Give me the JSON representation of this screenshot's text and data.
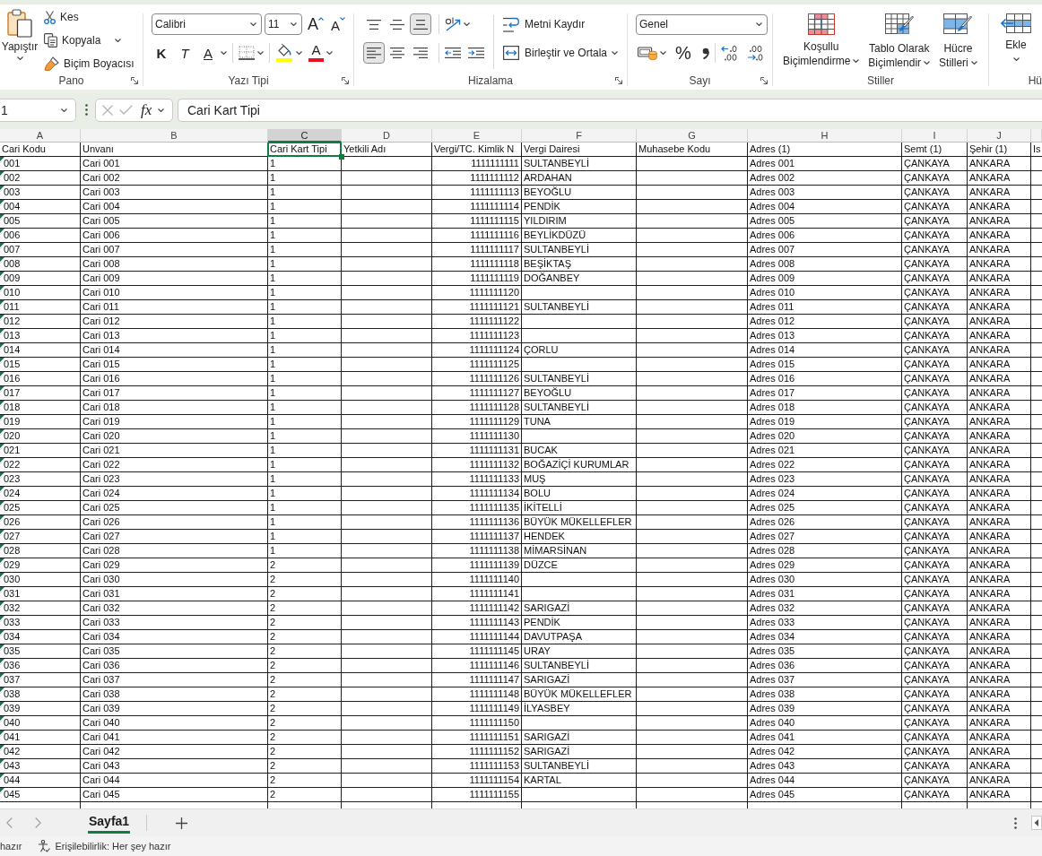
{
  "ribbon": {
    "clipboard": {
      "label": "Pano",
      "paste": "Yapıştır",
      "cut": "Kes",
      "copy": "Kopyala",
      "format_painter": "Biçim Boyacısı"
    },
    "font": {
      "label": "Yazı Tipi",
      "font_name": "Calibri",
      "font_size": "11",
      "grow_font": "A",
      "shrink_font": "A",
      "bold": "K",
      "italic": "T",
      "underline": "A",
      "font_color": "A"
    },
    "alignment": {
      "label": "Hizalama",
      "vertical": [
        {
          "kind": "top",
          "selected": false
        },
        {
          "kind": "middle",
          "selected": false
        },
        {
          "kind": "bottom",
          "selected": true
        }
      ],
      "horizontal": [
        {
          "kind": "left",
          "selected": true
        },
        {
          "kind": "center",
          "selected": false
        },
        {
          "kind": "right",
          "selected": false
        }
      ],
      "wrap_text": "Metni Kaydır",
      "merge_center": "Birleştir ve Ortala"
    },
    "number": {
      "label": "Sayı",
      "format": "Genel",
      "percent": "%"
    },
    "styles": {
      "label": "Stiller",
      "buttons": [
        {
          "kind": "conditional",
          "lines": [
            "Koşullu",
            "Biçimlendirme"
          ]
        },
        {
          "kind": "table",
          "lines": [
            "Tablo Olarak",
            "Biçimlendir"
          ]
        },
        {
          "kind": "cell",
          "lines": [
            "Hücre",
            "Stilleri"
          ]
        }
      ]
    },
    "cells": {
      "label": "Hü",
      "insert": "Ekle"
    }
  },
  "formula_bar": {
    "name_box": "1",
    "function_button": "fx",
    "formula": "Cari Kart Tipi"
  },
  "sheet": {
    "columns": [
      {
        "letter": "A",
        "heading": "Cari Kodu",
        "selected": false
      },
      {
        "letter": "B",
        "heading": "Unvanı",
        "selected": false
      },
      {
        "letter": "C",
        "heading": "Cari Kart Tipi",
        "selected": true
      },
      {
        "letter": "D",
        "heading": "Yetkili Adı",
        "selected": false
      },
      {
        "letter": "E",
        "heading": "Vergi/TC. Kimlik N",
        "selected": false
      },
      {
        "letter": "F",
        "heading": "Vergi Dairesi",
        "selected": false
      },
      {
        "letter": "G",
        "heading": "Muhasebe Kodu",
        "selected": false
      },
      {
        "letter": "H",
        "heading": "Adres (1)",
        "selected": false
      },
      {
        "letter": "I",
        "heading": "Semt (1)",
        "selected": false
      },
      {
        "letter": "J",
        "heading": "Şehir (1)",
        "selected": false
      },
      {
        "heading": "Is",
        "selected": false
      }
    ],
    "rows": [
      {
        "code": "001",
        "title": "Cari 001",
        "card_type": "1",
        "tax_number": "1111111111",
        "tax_office": "SULTANBEYLİ",
        "address": "Adres 001",
        "district": "ÇANKAYA",
        "city": "ANKARA",
        "warning": true
      },
      {
        "code": "002",
        "title": "Cari 002",
        "card_type": "1",
        "tax_number": "1111111112",
        "tax_office": "ARDAHAN",
        "address": "Adres 002",
        "district": "ÇANKAYA",
        "city": "ANKARA",
        "warning": true
      },
      {
        "code": "003",
        "title": "Cari 003",
        "card_type": "1",
        "tax_number": "1111111113",
        "tax_office": "BEYOĞLU",
        "address": "Adres 003",
        "district": "ÇANKAYA",
        "city": "ANKARA",
        "warning": true
      },
      {
        "code": "004",
        "title": "Cari 004",
        "card_type": "1",
        "tax_number": "1111111114",
        "tax_office": "PENDİK",
        "address": "Adres 004",
        "district": "ÇANKAYA",
        "city": "ANKARA",
        "warning": true
      },
      {
        "code": "005",
        "title": "Cari 005",
        "card_type": "1",
        "tax_number": "1111111115",
        "tax_office": "YILDIRIM",
        "address": "Adres 005",
        "district": "ÇANKAYA",
        "city": "ANKARA",
        "warning": true
      },
      {
        "code": "006",
        "title": "Cari 006",
        "card_type": "1",
        "tax_number": "1111111116",
        "tax_office": "BEYLİKDÜZÜ",
        "address": "Adres 006",
        "district": "ÇANKAYA",
        "city": "ANKARA",
        "warning": true
      },
      {
        "code": "007",
        "title": "Cari 007",
        "card_type": "1",
        "tax_number": "1111111117",
        "tax_office": "SULTANBEYLİ",
        "address": "Adres 007",
        "district": "ÇANKAYA",
        "city": "ANKARA",
        "warning": true
      },
      {
        "code": "008",
        "title": "Cari 008",
        "card_type": "1",
        "tax_number": "1111111118",
        "tax_office": "BEŞİKTAŞ",
        "address": "Adres 008",
        "district": "ÇANKAYA",
        "city": "ANKARA",
        "warning": true
      },
      {
        "code": "009",
        "title": "Cari 009",
        "card_type": "1",
        "tax_number": "1111111119",
        "tax_office": "DOĞANBEY",
        "address": "Adres 009",
        "district": "ÇANKAYA",
        "city": "ANKARA",
        "warning": true
      },
      {
        "code": "010",
        "title": "Cari 010",
        "card_type": "1",
        "tax_number": "1111111120",
        "address": "Adres 010",
        "district": "ÇANKAYA",
        "city": "ANKARA",
        "warning": true
      },
      {
        "code": "011",
        "title": "Cari 011",
        "card_type": "1",
        "tax_number": "1111111121",
        "tax_office": "SULTANBEYLİ",
        "address": "Adres 011",
        "district": "ÇANKAYA",
        "city": "ANKARA",
        "warning": true
      },
      {
        "code": "012",
        "title": "Cari 012",
        "card_type": "1",
        "tax_number": "1111111122",
        "address": "Adres 012",
        "district": "ÇANKAYA",
        "city": "ANKARA",
        "warning": true
      },
      {
        "code": "013",
        "title": "Cari 013",
        "card_type": "1",
        "tax_number": "1111111123",
        "address": "Adres 013",
        "district": "ÇANKAYA",
        "city": "ANKARA",
        "warning": true
      },
      {
        "code": "014",
        "title": "Cari 014",
        "card_type": "1",
        "tax_number": "1111111124",
        "tax_office": "ÇORLU",
        "address": "Adres 014",
        "district": "ÇANKAYA",
        "city": "ANKARA",
        "warning": true
      },
      {
        "code": "015",
        "title": "Cari 015",
        "card_type": "1",
        "tax_number": "1111111125",
        "address": "Adres 015",
        "district": "ÇANKAYA",
        "city": "ANKARA",
        "warning": true
      },
      {
        "code": "016",
        "title": "Cari 016",
        "card_type": "1",
        "tax_number": "1111111126",
        "tax_office": "SULTANBEYLİ",
        "address": "Adres 016",
        "district": "ÇANKAYA",
        "city": "ANKARA",
        "warning": true
      },
      {
        "code": "017",
        "title": "Cari 017",
        "card_type": "1",
        "tax_number": "1111111127",
        "tax_office": "BEYOĞLU",
        "address": "Adres 017",
        "district": "ÇANKAYA",
        "city": "ANKARA",
        "warning": true
      },
      {
        "code": "018",
        "title": "Cari 018",
        "card_type": "1",
        "tax_number": "1111111128",
        "tax_office": "SULTANBEYLİ",
        "address": "Adres 018",
        "district": "ÇANKAYA",
        "city": "ANKARA",
        "warning": true
      },
      {
        "code": "019",
        "title": "Cari 019",
        "card_type": "1",
        "tax_number": "1111111129",
        "tax_office": "TUNA",
        "address": "Adres 019",
        "district": "ÇANKAYA",
        "city": "ANKARA",
        "warning": true
      },
      {
        "code": "020",
        "title": "Cari 020",
        "card_type": "1",
        "tax_number": "1111111130",
        "address": "Adres 020",
        "district": "ÇANKAYA",
        "city": "ANKARA",
        "warning": true
      },
      {
        "code": "021",
        "title": "Cari 021",
        "card_type": "1",
        "tax_number": "1111111131",
        "tax_office": "BUCAK",
        "address": "Adres 021",
        "district": "ÇANKAYA",
        "city": "ANKARA",
        "warning": true
      },
      {
        "code": "022",
        "title": "Cari 022",
        "card_type": "1",
        "tax_number": "1111111132",
        "tax_office": "BOĞAZİÇİ KURUMLAR",
        "address": "Adres 022",
        "district": "ÇANKAYA",
        "city": "ANKARA",
        "warning": true
      },
      {
        "code": "023",
        "title": "Cari 023",
        "card_type": "1",
        "tax_number": "1111111133",
        "tax_office": "MUŞ",
        "address": "Adres 023",
        "district": "ÇANKAYA",
        "city": "ANKARA",
        "warning": true
      },
      {
        "code": "024",
        "title": "Cari 024",
        "card_type": "1",
        "tax_number": "1111111134",
        "tax_office": "BOLU",
        "address": "Adres 024",
        "district": "ÇANKAYA",
        "city": "ANKARA",
        "warning": true
      },
      {
        "code": "025",
        "title": "Cari 025",
        "card_type": "1",
        "tax_number": "1111111135",
        "tax_office": "İKİTELLİ",
        "address": "Adres 025",
        "district": "ÇANKAYA",
        "city": "ANKARA",
        "warning": true
      },
      {
        "code": "026",
        "title": "Cari 026",
        "card_type": "1",
        "tax_number": "1111111136",
        "tax_office": "BÜYÜK MÜKELLEFLER",
        "address": "Adres 026",
        "district": "ÇANKAYA",
        "city": "ANKARA",
        "warning": true
      },
      {
        "code": "027",
        "title": "Cari 027",
        "card_type": "1",
        "tax_number": "1111111137",
        "tax_office": "HENDEK",
        "address": "Adres 027",
        "district": "ÇANKAYA",
        "city": "ANKARA",
        "warning": true
      },
      {
        "code": "028",
        "title": "Cari 028",
        "card_type": "1",
        "tax_number": "1111111138",
        "tax_office": "MİMARSİNAN",
        "address": "Adres 028",
        "district": "ÇANKAYA",
        "city": "ANKARA",
        "warning": true
      },
      {
        "code": "029",
        "title": "Cari 029",
        "card_type": "2",
        "tax_number": "1111111139",
        "tax_office": "DÜZCE",
        "address": "Adres 029",
        "district": "ÇANKAYA",
        "city": "ANKARA",
        "warning": true
      },
      {
        "code": "030",
        "title": "Cari 030",
        "card_type": "2",
        "tax_number": "1111111140",
        "address": "Adres 030",
        "district": "ÇANKAYA",
        "city": "ANKARA",
        "warning": true
      },
      {
        "code": "031",
        "title": "Cari 031",
        "card_type": "2",
        "tax_number": "1111111141",
        "address": "Adres 031",
        "district": "ÇANKAYA",
        "city": "ANKARA",
        "warning": true
      },
      {
        "code": "032",
        "title": "Cari 032",
        "card_type": "2",
        "tax_number": "1111111142",
        "tax_office": "SARIGAZİ",
        "address": "Adres 032",
        "district": "ÇANKAYA",
        "city": "ANKARA",
        "warning": true
      },
      {
        "code": "033",
        "title": "Cari 033",
        "card_type": "2",
        "tax_number": "1111111143",
        "tax_office": "PENDİK",
        "address": "Adres 033",
        "district": "ÇANKAYA",
        "city": "ANKARA",
        "warning": true
      },
      {
        "code": "034",
        "title": "Cari 034",
        "card_type": "2",
        "tax_number": "1111111144",
        "tax_office": "DAVUTPAŞA",
        "address": "Adres 034",
        "district": "ÇANKAYA",
        "city": "ANKARA",
        "warning": true
      },
      {
        "code": "035",
        "title": "Cari 035",
        "card_type": "2",
        "tax_number": "1111111145",
        "tax_office": "URAY",
        "address": "Adres 035",
        "district": "ÇANKAYA",
        "city": "ANKARA",
        "warning": true
      },
      {
        "code": "036",
        "title": "Cari 036",
        "card_type": "2",
        "tax_number": "1111111146",
        "tax_office": "SULTANBEYLİ",
        "address": "Adres 036",
        "district": "ÇANKAYA",
        "city": "ANKARA",
        "warning": true
      },
      {
        "code": "037",
        "title": "Cari 037",
        "card_type": "2",
        "tax_number": "1111111147",
        "tax_office": "SARIGAZİ",
        "address": "Adres 037",
        "district": "ÇANKAYA",
        "city": "ANKARA",
        "warning": true
      },
      {
        "code": "038",
        "title": "Cari 038",
        "card_type": "2",
        "tax_number": "1111111148",
        "tax_office": "BÜYÜK MÜKELLEFLER",
        "address": "Adres 038",
        "district": "ÇANKAYA",
        "city": "ANKARA",
        "warning": true
      },
      {
        "code": "039",
        "title": "Cari 039",
        "card_type": "2",
        "tax_number": "1111111149",
        "tax_office": "İLYASBEY",
        "address": "Adres 039",
        "district": "ÇANKAYA",
        "city": "ANKARA",
        "warning": true
      },
      {
        "code": "040",
        "title": "Cari 040",
        "card_type": "2",
        "tax_number": "1111111150",
        "address": "Adres 040",
        "district": "ÇANKAYA",
        "city": "ANKARA",
        "warning": true
      },
      {
        "code": "041",
        "title": "Cari 041",
        "card_type": "2",
        "tax_number": "1111111151",
        "tax_office": "SARIGAZİ",
        "address": "Adres 041",
        "district": "ÇANKAYA",
        "city": "ANKARA",
        "warning": true
      },
      {
        "code": "042",
        "title": "Cari 042",
        "card_type": "2",
        "tax_number": "1111111152",
        "tax_office": "SARIGAZİ",
        "address": "Adres 042",
        "district": "ÇANKAYA",
        "city": "ANKARA",
        "warning": true
      },
      {
        "code": "043",
        "title": "Cari 043",
        "card_type": "2",
        "tax_number": "1111111153",
        "tax_office": "SULTANBEYLİ",
        "address": "Adres 043",
        "district": "ÇANKAYA",
        "city": "ANKARA",
        "warning": true
      },
      {
        "code": "044",
        "title": "Cari 044",
        "card_type": "2",
        "tax_number": "1111111154",
        "tax_office": "KARTAL",
        "address": "Adres 044",
        "district": "ÇANKAYA",
        "city": "ANKARA",
        "warning": true
      },
      {
        "code": "045",
        "title": "Cari 045",
        "card_type": "2",
        "tax_number": "1111111155",
        "address": "Adres 045",
        "district": "ÇANKAYA",
        "city": "ANKARA",
        "warning": true
      }
    ]
  },
  "sheet_tabs": [
    {
      "label": "Sayfa1",
      "selected": true
    }
  ],
  "status_bar": {
    "mode": "hazır",
    "accessibility": "Erişilebilirlik: Her şey hazır"
  }
}
